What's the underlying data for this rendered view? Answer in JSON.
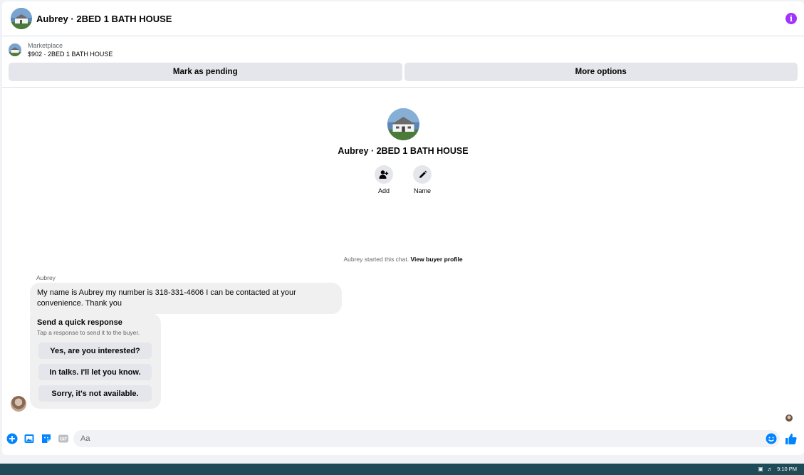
{
  "header": {
    "title": "Aubrey · 2BED 1 BATH HOUSE",
    "info_icon": "info-icon",
    "accent": "#a033ff"
  },
  "listing": {
    "label": "Marketplace",
    "price_title": "$902 · 2BED 1 BATH HOUSE"
  },
  "actions": {
    "mark_pending": "Mark as pending",
    "more_options": "More options"
  },
  "profile": {
    "name": "Aubrey · 2BED 1 BATH HOUSE",
    "add_label": "Add",
    "name_label": "Name"
  },
  "chat": {
    "started_text": "Aubrey started this chat. ",
    "view_profile": "View buyer profile",
    "sender": "Aubrey",
    "message": "My name is Aubrey my number is 318-331-4606 I can be contacted at your convenience. Thank you"
  },
  "quick_response": {
    "title": "Send a quick response",
    "subtitle": "Tap a response to send it to the buyer.",
    "options": [
      "Yes, are you interested?",
      "In talks. I'll let you know.",
      "Sorry, it's not available."
    ]
  },
  "composer": {
    "placeholder": "Aa",
    "accent": "#0084ff"
  },
  "taskbar": {
    "time": "9:10 PM"
  }
}
